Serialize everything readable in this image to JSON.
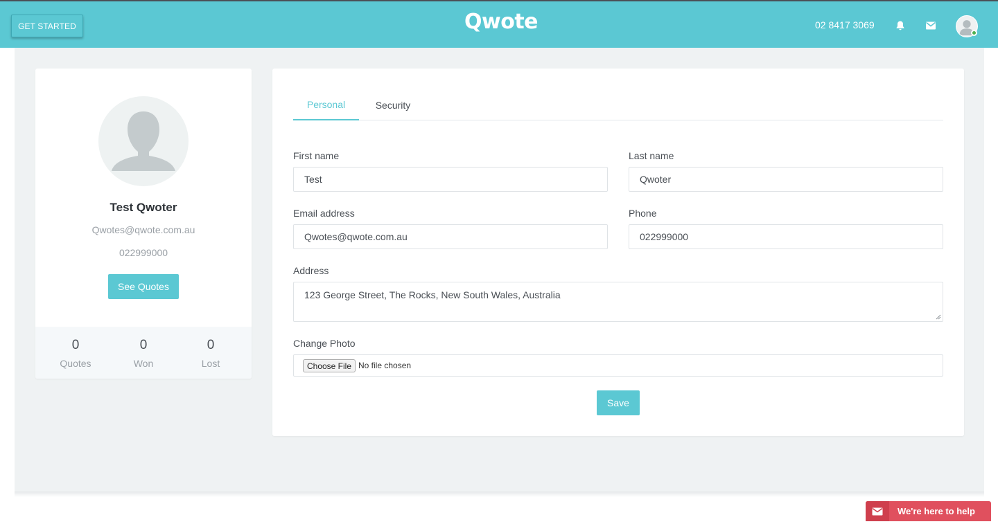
{
  "topbar": {
    "get_started_label": "GET STARTED",
    "logo_text": "Qwote",
    "phone": "02 8417 3069",
    "icons": [
      "bell-icon",
      "mail-icon",
      "user-avatar-icon"
    ],
    "accent_color": "#5bc8d3"
  },
  "profile": {
    "name": "Test Qwoter",
    "email": "Qwotes@qwote.com.au",
    "phone": "022999000",
    "see_quotes_label": "See Quotes",
    "stats": [
      {
        "value": "0",
        "label": "Quotes"
      },
      {
        "value": "0",
        "label": "Won"
      },
      {
        "value": "0",
        "label": "Lost"
      }
    ]
  },
  "tabs": [
    {
      "label": "Personal",
      "active": true
    },
    {
      "label": "Security",
      "active": false
    }
  ],
  "form": {
    "first_name_label": "First name",
    "first_name_value": "Test",
    "last_name_label": "Last name",
    "last_name_value": "Qwoter",
    "email_label": "Email address",
    "email_value": "Qwotes@qwote.com.au",
    "phone_label": "Phone",
    "phone_value": "022999000",
    "address_label": "Address",
    "address_value": "123 George Street, The Rocks, New South Wales, Australia",
    "photo_label": "Change Photo",
    "choose_file_label": "Choose File",
    "file_status": "No file chosen",
    "save_label": "Save"
  },
  "help_widget": {
    "label": "We're here to help",
    "color": "#e0505e"
  }
}
